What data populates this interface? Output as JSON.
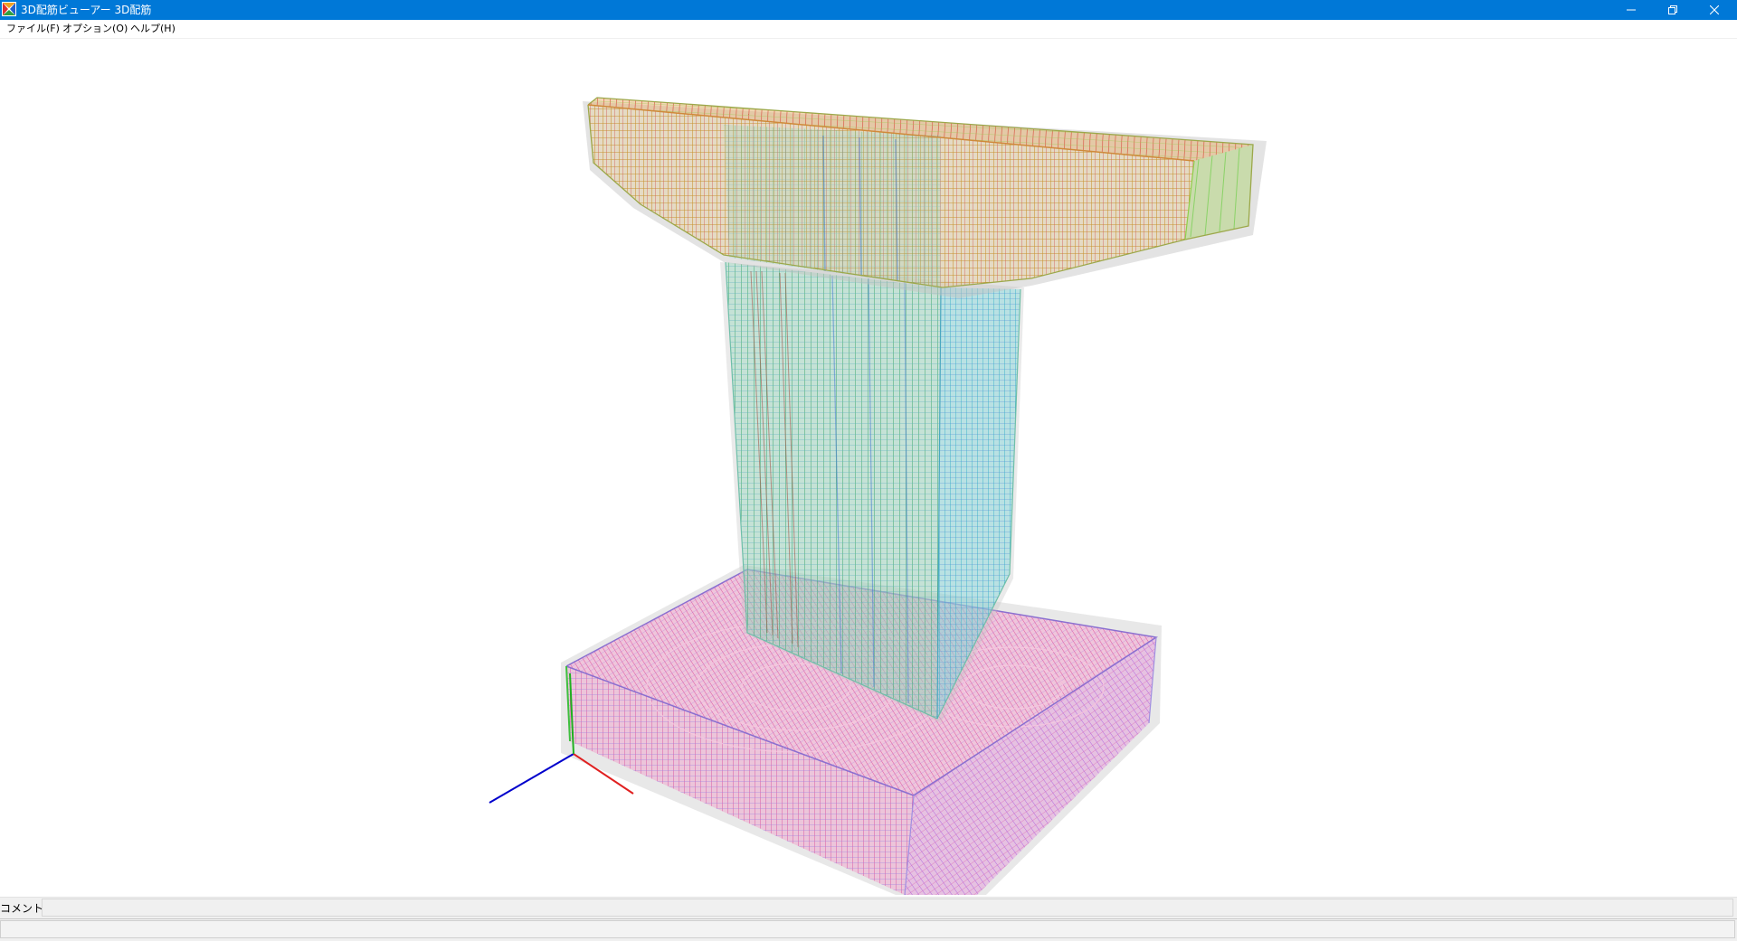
{
  "window": {
    "title": "3D配筋ビューアー 3D配筋",
    "controls": {
      "minimize_icon": "minimize-icon",
      "maximize_icon": "restore-icon",
      "close_icon": "close-icon"
    }
  },
  "menu": {
    "items": [
      {
        "label": "ファイル(F)"
      },
      {
        "label": "オプション(O)"
      },
      {
        "label": "ヘルプ(H)"
      }
    ]
  },
  "viewport": {
    "model": "pier-rebar-3d",
    "colors": {
      "cap_rebar": "#c8a04a",
      "cap_green": "#6fcf4a",
      "column_green": "#5ab878",
      "column_cyan": "#5fc6cf",
      "footing_pink": "#e06aa8",
      "footing_violet": "#9a7fe0",
      "concrete": "#c9c9c9",
      "axis_x": "#e02020",
      "axis_y": "#20b020",
      "axis_z": "#0000cc"
    }
  },
  "comment": {
    "label": "コメント:",
    "value": ""
  },
  "status": {
    "text": ""
  }
}
